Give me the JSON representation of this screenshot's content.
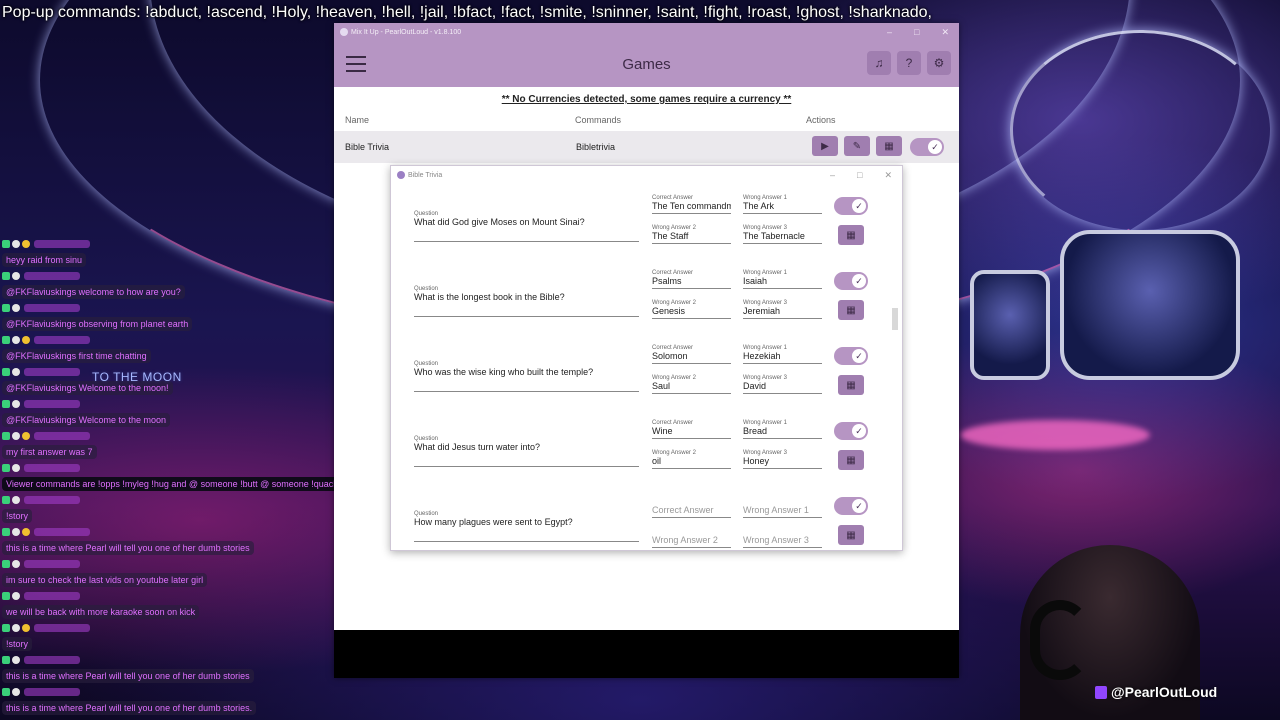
{
  "overlay": {
    "popup_commands": "Pop-up commands: !abduct, !ascend, !Holy, !heaven, !hell,  !jail, !bfact, !fact, !smite, !sninner, !saint, !fight, !roast, !ghost, !sharknado,",
    "moon_text": "TO THE MOON",
    "handle": "@PearlOutLoud"
  },
  "chat": [
    {
      "message": "heyy raid from sinu"
    },
    {
      "message": "@FKFlaviuskings welcome to how are you?"
    },
    {
      "message": "@FKFlaviuskings observing from planet earth"
    },
    {
      "message": "@FKFlaviuskings first time chatting"
    },
    {
      "message": "@FKFlaviuskings Welcome to the moon!"
    },
    {
      "message": "@FKFlaviuskings Welcome to the moon"
    },
    {
      "message": "my first answer was 7"
    },
    {
      "message": "Viewer commands are !opps !myleg !hug and @ someone !butt @ someone !quack !fluffy !crySS !punch and @ someone",
      "wide": true
    },
    {
      "message": "!story"
    },
    {
      "message": "this is a time where Pearl will tell you one of her dumb stories"
    },
    {
      "message": "im sure to check the last vids on youtube later girl"
    },
    {
      "message": "we will be back with more karaoke soon on kick"
    },
    {
      "message": "!story"
    },
    {
      "message": "this is a time where Pearl will tell you one of her dumb stories"
    },
    {
      "message": "this is a time where Pearl will tell you one of her dumb stories."
    }
  ],
  "app": {
    "window_title": "Mix It Up - PearlOutLoud - v1.8.100",
    "page_title": "Games",
    "notice": "** No Currencies detected, some games require a currency **",
    "columns": {
      "name": "Name",
      "commands": "Commands",
      "actions": "Actions"
    },
    "game": {
      "name": "Bible Trivia",
      "command": "Bibletrivia",
      "enabled": true
    },
    "icons": {
      "menu": "hamburger-icon",
      "bell": "bell-icon",
      "help": "help-icon",
      "settings": "gear-icon"
    }
  },
  "dialog": {
    "title": "Bible Trivia",
    "labels": {
      "question": "Question",
      "correct": "Correct Answer",
      "wrong1": "Wrong Answer 1",
      "wrong2": "Wrong Answer 2",
      "wrong3": "Wrong Answer 3"
    },
    "questions": [
      {
        "question": "What did God give Moses on Mount Sinai?",
        "correct": "The Ten commandments",
        "wrong1": "The Ark",
        "wrong2": "The Staff",
        "wrong3": "The Tabernacle"
      },
      {
        "question": "What is the longest book in the Bible?",
        "correct": "Psalms",
        "wrong1": "Isaiah",
        "wrong2": "Genesis",
        "wrong3": "Jeremiah"
      },
      {
        "question": "Who was the wise king who built the temple?",
        "correct": "Solomon",
        "wrong1": "Hezekiah",
        "wrong2": "Saul",
        "wrong3": "David"
      },
      {
        "question": "What did Jesus turn water into?",
        "correct": "Wine",
        "wrong1": "Bread",
        "wrong2": "oil",
        "wrong3": "Honey"
      },
      {
        "question": "How many plagues were sent to Egypt?",
        "correct": "",
        "wrong1": "",
        "wrong2": "",
        "wrong3": ""
      }
    ]
  },
  "colors": {
    "accent": "#b695c3",
    "accent_dark": "#a07eb0"
  }
}
